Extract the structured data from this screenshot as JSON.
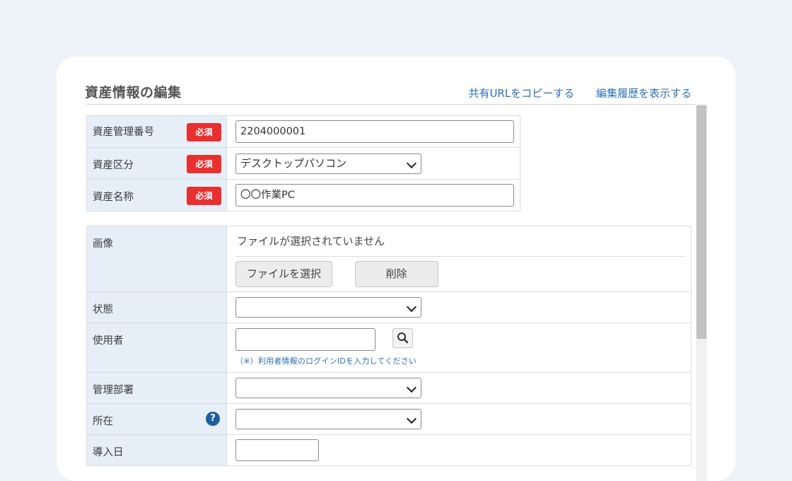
{
  "page": {
    "heading": "資産情報の編集",
    "links": {
      "copy_url": "共有URLをコピーする",
      "history": "編集履歴を表示する"
    }
  },
  "required_badge": "必須",
  "basic": {
    "asset_number": {
      "label": "資産管理番号",
      "value": "2204000001"
    },
    "asset_category": {
      "label": "資産区分",
      "value": "デスクトップパソコン"
    },
    "asset_name": {
      "label": "資産名称",
      "value": "〇〇作業PC"
    }
  },
  "details": {
    "image": {
      "label": "画像",
      "file_status": "ファイルが選択されていません",
      "choose_button": "ファイルを選択",
      "delete_button": "削除"
    },
    "status": {
      "label": "状態",
      "value": ""
    },
    "user": {
      "label": "使用者",
      "value": "",
      "hint": "（※）利用者情報のログインIDを入力してください"
    },
    "department": {
      "label": "管理部署",
      "value": ""
    },
    "location": {
      "label": "所在",
      "value": "",
      "help_symbol": "?"
    },
    "install_date": {
      "label": "導入日",
      "value": ""
    }
  },
  "colors": {
    "accent": "#2d6fb6",
    "required": "#e8302f",
    "label_bg": "#e6eff8"
  }
}
